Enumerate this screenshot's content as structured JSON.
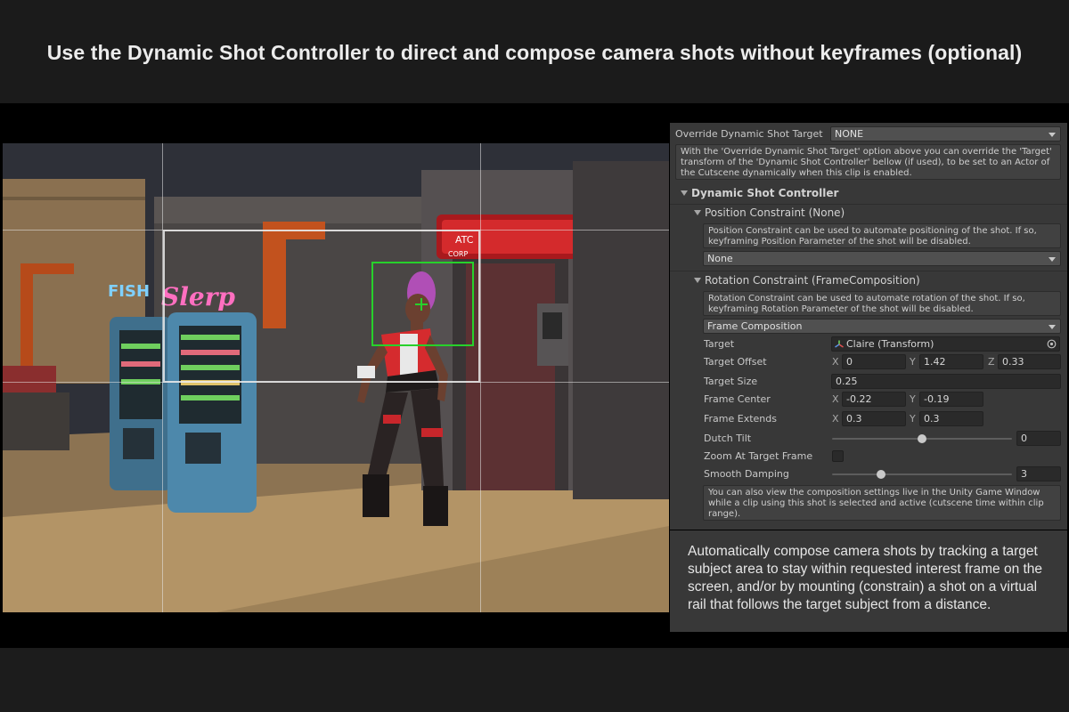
{
  "headline": "Use the Dynamic Shot Controller to direct and compose camera shots without keyframes (optional)",
  "scene_signs": {
    "fish": "FISH",
    "slerp": "Slerp",
    "atc": "ATC",
    "corp": "CORP"
  },
  "inspector": {
    "override_label": "Override Dynamic Shot Target",
    "override_value": "NONE",
    "override_help": "With the 'Override Dynamic Shot Target' option above you can override the 'Target' transform of the 'Dynamic Shot Controller' bellow (if used), to be set to an Actor of the Cutscene dynamically when this clip is enabled.",
    "dsc_title": "Dynamic Shot Controller",
    "position_constraint": {
      "title": "Position Constraint (None)",
      "help": "Position Constraint can be used to automate positioning of the shot. If so, keyframing Position Parameter of the shot will be disabled.",
      "value": "None"
    },
    "rotation_constraint": {
      "title": "Rotation Constraint (FrameComposition)",
      "help": "Rotation Constraint can be used to automate rotation of the shot. If so, keyframing Rotation Parameter of the shot will be disabled.",
      "value": "Frame Composition"
    },
    "target": {
      "label": "Target",
      "value": "Claire (Transform)"
    },
    "target_offset": {
      "label": "Target Offset",
      "x_axis": "X",
      "y_axis": "Y",
      "z_axis": "Z",
      "x": "0",
      "y": "1.42",
      "z": "0.33"
    },
    "target_size": {
      "label": "Target Size",
      "value": "0.25"
    },
    "frame_center": {
      "label": "Frame Center",
      "x_axis": "X",
      "y_axis": "Y",
      "x": "-0.22",
      "y": "-0.19"
    },
    "frame_extends": {
      "label": "Frame Extends",
      "x_axis": "X",
      "y_axis": "Y",
      "x": "0.3",
      "y": "0.3"
    },
    "dutch_tilt": {
      "label": "Dutch Tilt",
      "value": "0",
      "slider_fraction": 0.5
    },
    "zoom_at_target": {
      "label": "Zoom At Target Frame",
      "checked": false
    },
    "smooth_damping": {
      "label": "Smooth Damping",
      "value": "3",
      "slider_fraction": 0.27
    },
    "footer_help": "You can also view the composition settings live in the Unity Game Window while a clip using this shot is selected and active (cutscene time within clip range)."
  },
  "caption": "Automatically compose camera shots by tracking a target subject area to stay within requested interest frame on the screen, and/or by mounting (constrain) a shot on a virtual rail that follows the target subject from a distance.",
  "colors": {
    "target_frame": "#27d12b",
    "panel_bg": "#383838",
    "field_bg": "#2a2a2a"
  }
}
